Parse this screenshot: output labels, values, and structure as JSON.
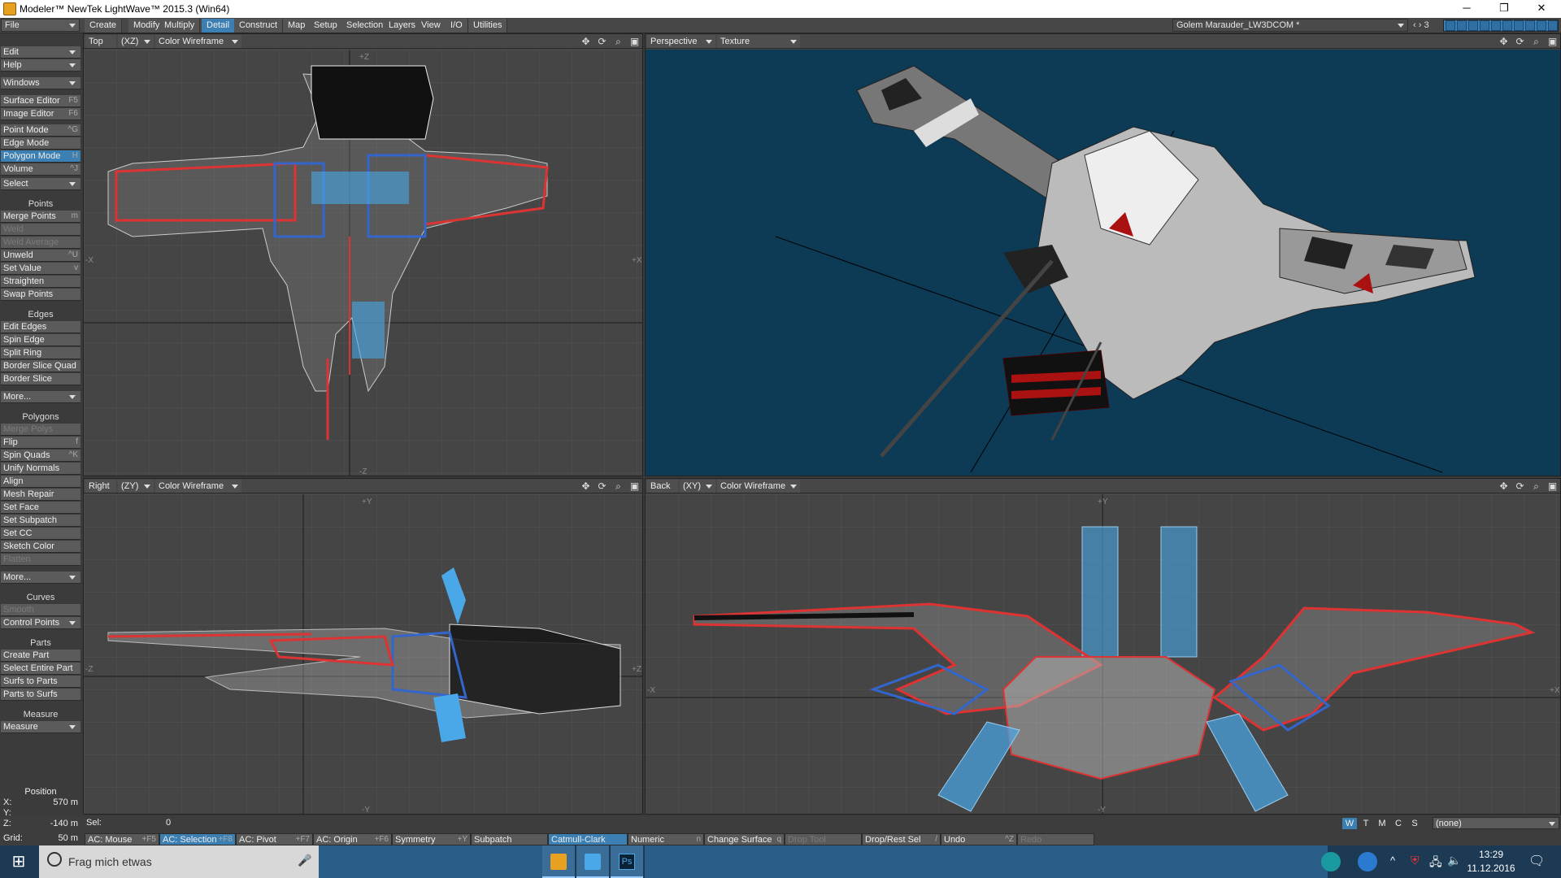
{
  "title": "Modeler™ NewTek LightWave™ 2015.3 (Win64)",
  "window_controls": {
    "minimize": "─",
    "restore": "❐",
    "close": "✕"
  },
  "tabs": [
    "Create",
    "Modify",
    "Multiply",
    "Detail",
    "Construct",
    "Map",
    "Setup",
    "Selection",
    "Layers",
    "View",
    "I/O",
    "Utilities"
  ],
  "active_tab": "Detail",
  "object_name": "Golem Marauder_LW3DCOM *",
  "layer_num": "3",
  "sidebar": {
    "top": [
      {
        "label": "File"
      },
      {
        "label": "Edit"
      },
      {
        "label": "Help"
      },
      {
        "label": "Windows"
      }
    ],
    "editors": [
      {
        "label": "Surface Editor",
        "key": "F5"
      },
      {
        "label": "Image Editor",
        "key": "F6"
      }
    ],
    "modes": [
      {
        "label": "Point Mode",
        "key": "^G"
      },
      {
        "label": "Edge Mode",
        "key": ""
      },
      {
        "label": "Polygon Mode",
        "key": "H"
      },
      {
        "label": "Volume",
        "key": "^J"
      }
    ],
    "select": "Select",
    "points_header": "Points",
    "points": [
      {
        "label": "Merge Points",
        "key": "m"
      },
      {
        "label": "Weld",
        "key": ""
      },
      {
        "label": "Weld Average",
        "key": ""
      },
      {
        "label": "Unweld",
        "key": "^U"
      },
      {
        "label": "Set Value",
        "key": "v"
      },
      {
        "label": "Straighten",
        "key": ""
      },
      {
        "label": "Swap Points",
        "key": ""
      }
    ],
    "edges_header": "Edges",
    "edges": [
      {
        "label": "Edit Edges"
      },
      {
        "label": "Spin Edge"
      },
      {
        "label": "Split Ring"
      },
      {
        "label": "Border Slice Quad"
      },
      {
        "label": "Border Slice"
      }
    ],
    "more1": "More...",
    "polygons_header": "Polygons",
    "polygons": [
      {
        "label": "Merge Polys",
        "key": ""
      },
      {
        "label": "Flip",
        "key": "f"
      },
      {
        "label": "Spin Quads",
        "key": "^K"
      },
      {
        "label": "Unify Normals",
        "key": ""
      },
      {
        "label": "Align",
        "key": ""
      },
      {
        "label": "Mesh Repair",
        "key": ""
      },
      {
        "label": "Set Face",
        "key": ""
      },
      {
        "label": "Set Subpatch",
        "key": ""
      },
      {
        "label": "Set CC",
        "key": ""
      },
      {
        "label": "Sketch Color",
        "key": ""
      },
      {
        "label": "Flatten",
        "key": ""
      }
    ],
    "more2": "More...",
    "curves_header": "Curves",
    "curves": [
      {
        "label": "Smooth"
      },
      {
        "label": "Control Points"
      }
    ],
    "parts_header": "Parts",
    "parts": [
      {
        "label": "Create Part"
      },
      {
        "label": "Select Entire Part"
      },
      {
        "label": "Surfs to Parts"
      },
      {
        "label": "Parts to Surfs"
      }
    ],
    "measure_header": "Measure",
    "measure": "Measure",
    "position_header": "Position",
    "pos_x_label": "X:",
    "pos_x": "570 m",
    "pos_y_label": "Y:",
    "pos_y": "",
    "pos_z_label": "Z:",
    "pos_z": "-140 m",
    "grid_label": "Grid:",
    "grid": "50 m"
  },
  "viewports": {
    "top": {
      "name": "Top",
      "axis": "(XZ)",
      "mode": "Color Wireframe"
    },
    "persp": {
      "name": "Perspective",
      "mode": "Texture"
    },
    "right": {
      "name": "Right",
      "axis": "(ZY)",
      "mode": "Color Wireframe"
    },
    "back": {
      "name": "Back",
      "axis": "(XY)",
      "mode": "Color Wireframe"
    }
  },
  "axis_labels": {
    "plus_z": "+Z",
    "minus_z": "-Z",
    "plus_x": "+X",
    "minus_x": "-X",
    "plus_y": "+Y",
    "minus_y": "-Y"
  },
  "sel_label": "Sel:",
  "sel": "0",
  "wtmcs": [
    "W",
    "T",
    "M",
    "C",
    "S"
  ],
  "none_select": "(none)",
  "bottom_buttons": [
    {
      "label": "AC: Mouse",
      "key": "+F5"
    },
    {
      "label": "AC: Selection",
      "key": "+F8",
      "active": true
    },
    {
      "label": "AC: Pivot",
      "key": "+F7"
    },
    {
      "label": "AC: Origin",
      "key": "+F6"
    },
    {
      "label": "Symmetry",
      "key": "+Y"
    },
    {
      "label": "Subpatch",
      "key": ""
    },
    {
      "label": "Catmull-Clark",
      "key": "",
      "active": true
    },
    {
      "label": "Numeric",
      "key": "n"
    },
    {
      "label": "Change Surface",
      "key": "q"
    },
    {
      "label": "Drop Tool",
      "key": "",
      "dis": true
    },
    {
      "label": "Drop/Rest Sel",
      "key": "/"
    },
    {
      "label": "Undo",
      "key": "^Z"
    },
    {
      "label": "Redo",
      "key": "",
      "dis": true
    }
  ],
  "taskbar": {
    "search": "Frag mich etwas",
    "time": "13:29",
    "date": "11.12.2016"
  }
}
